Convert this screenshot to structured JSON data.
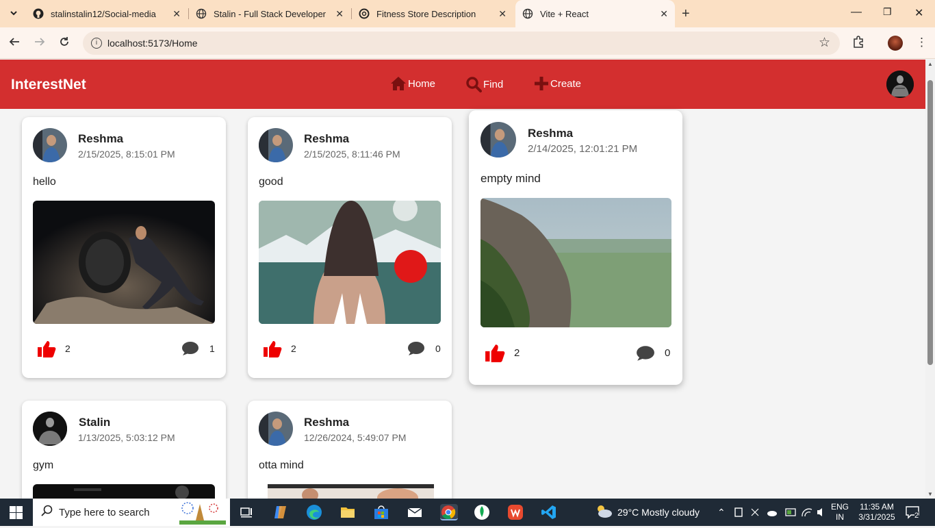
{
  "browser": {
    "tabs": [
      {
        "title": "stalinstalin12/Social-media",
        "favicon": "github-icon"
      },
      {
        "title": "Stalin - Full Stack Developer",
        "favicon": "globe-icon"
      },
      {
        "title": "Fitness Store Description",
        "favicon": "openai-icon"
      },
      {
        "title": "Vite + React",
        "favicon": "globe-icon",
        "active": true
      }
    ],
    "url": "localhost:5173/Home"
  },
  "app": {
    "brand": "InterestNet",
    "accent": "#d32f2f",
    "nav": [
      {
        "label": "Home",
        "icon": "home-icon"
      },
      {
        "label": "Find",
        "icon": "search-icon"
      },
      {
        "label": "Create",
        "icon": "plus-icon"
      }
    ]
  },
  "posts": [
    {
      "user": "Reshma",
      "time": "2/15/2025, 8:15:01 PM",
      "text": "hello",
      "likes": "2",
      "comments": "1"
    },
    {
      "user": "Reshma",
      "time": "2/15/2025, 8:11:46 PM",
      "text": "good",
      "likes": "2",
      "comments": "0"
    },
    {
      "user": "Reshma",
      "time": "2/14/2025, 12:01:21 PM",
      "text": "empty mind",
      "likes": "2",
      "comments": "0"
    },
    {
      "user": "Stalin",
      "time": "1/13/2025, 5:03:12 PM",
      "text": "gym",
      "likes": "",
      "comments": ""
    },
    {
      "user": "Reshma",
      "time": "12/26/2024, 5:49:07 PM",
      "text": "otta mind",
      "likes": "",
      "comments": ""
    }
  ],
  "taskbar": {
    "search_placeholder": "Type here to search",
    "weather": "29°C  Mostly cloudy",
    "lang_top": "ENG",
    "lang_bottom": "IN",
    "time": "11:35 AM",
    "date": "3/31/2025",
    "notifications": "2"
  }
}
